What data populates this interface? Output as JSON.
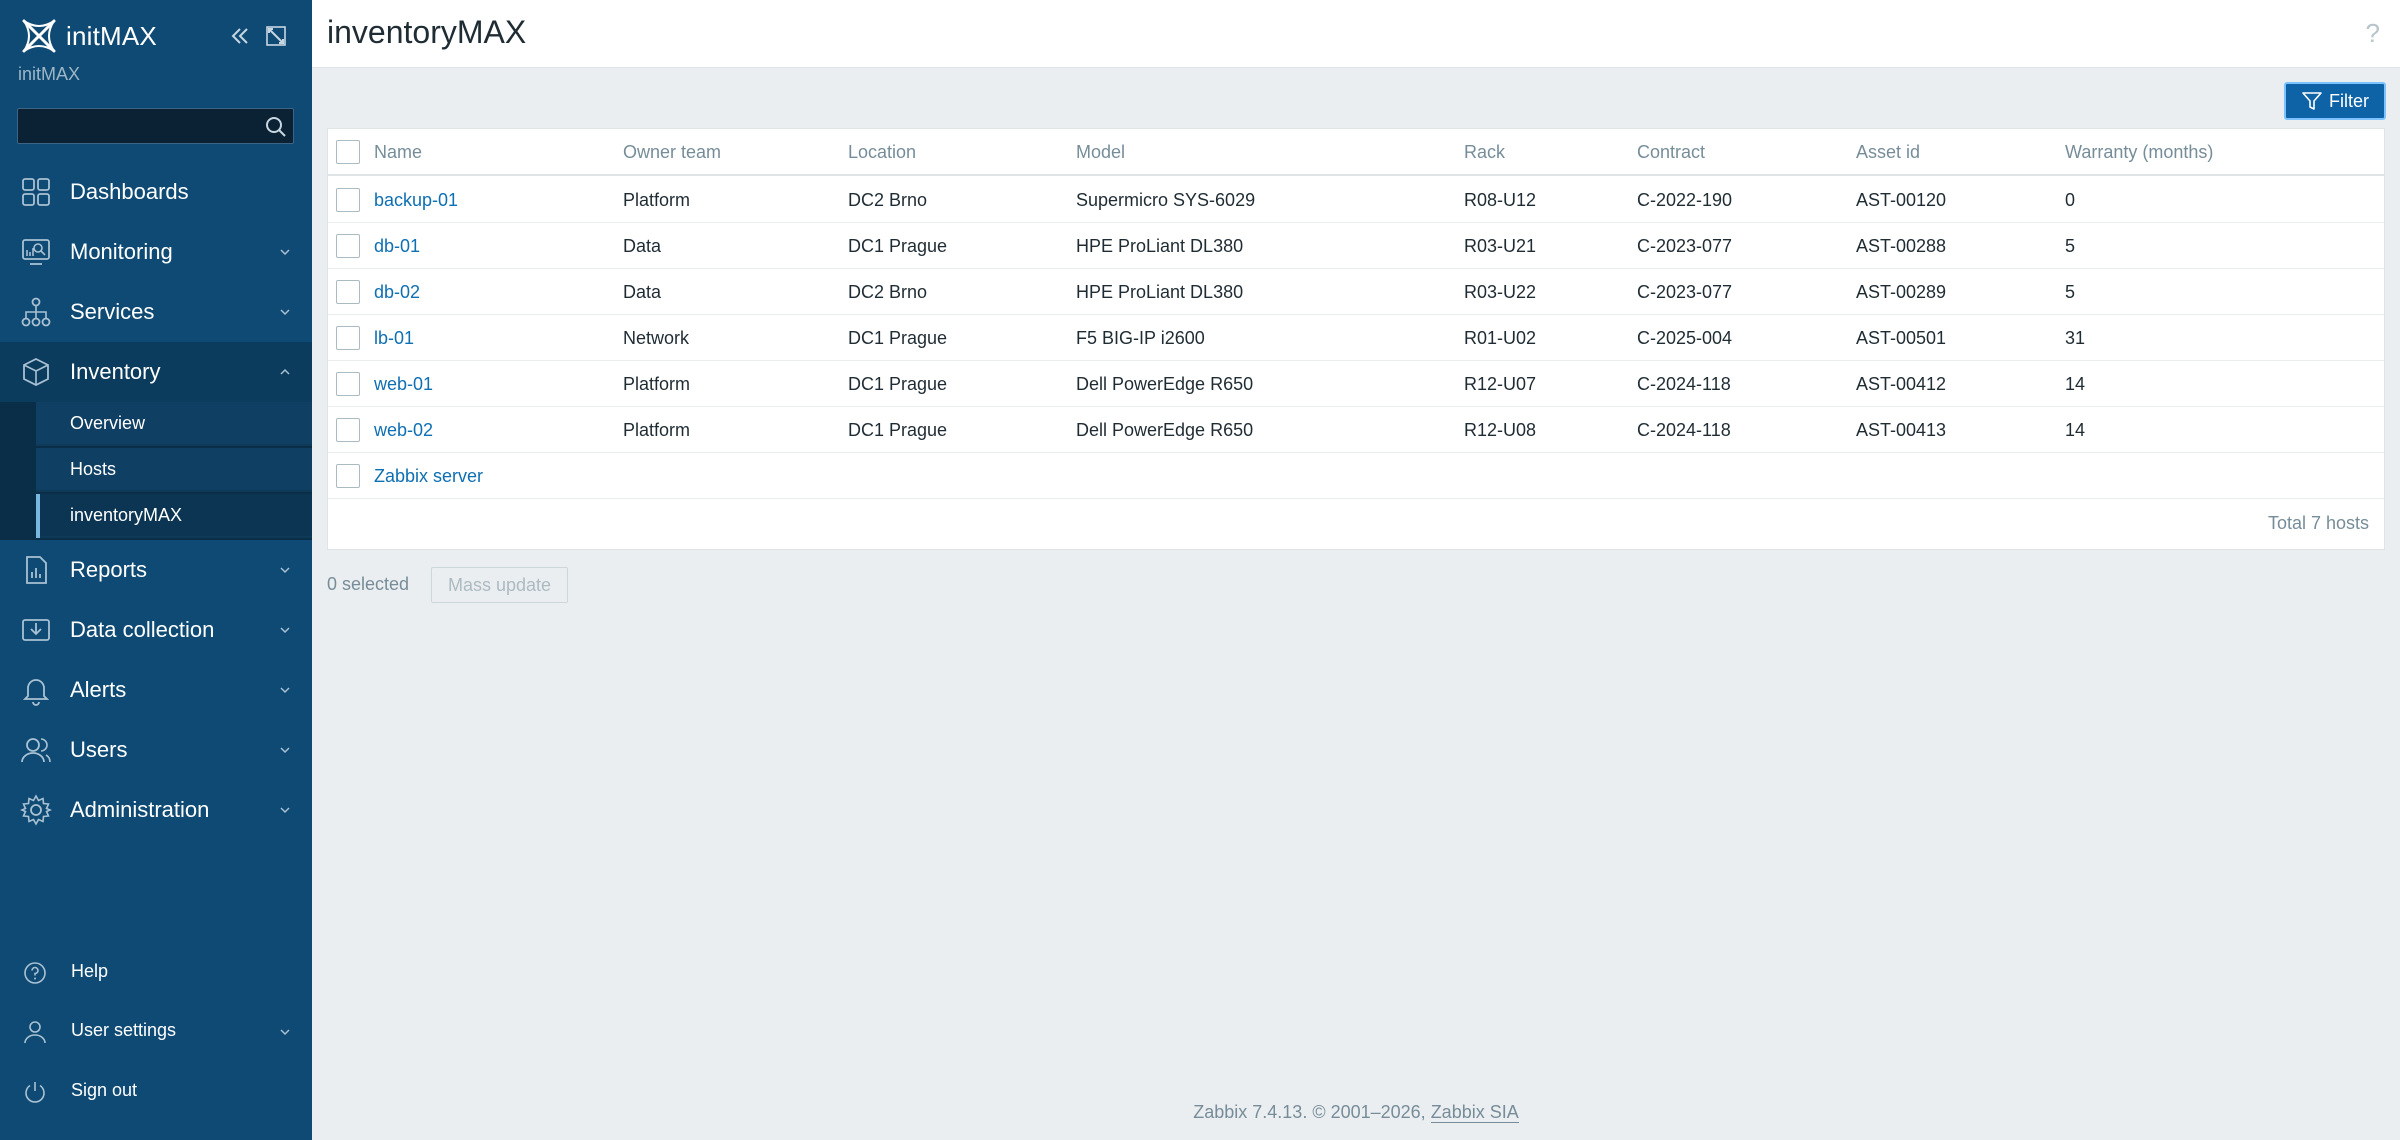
{
  "brand": {
    "name": "initMAX",
    "subtitle": "initMAX"
  },
  "search": {
    "placeholder": "",
    "value": ""
  },
  "nav": {
    "dashboards": "Dashboards",
    "monitoring": "Monitoring",
    "services": "Services",
    "inventory": "Inventory",
    "inventory_sub": [
      "Overview",
      "Hosts",
      "inventoryMAX"
    ],
    "reports": "Reports",
    "data_collection": "Data collection",
    "alerts": "Alerts",
    "users": "Users",
    "administration": "Administration"
  },
  "bottom_nav": {
    "help": "Help",
    "user_settings": "User settings",
    "sign_out": "Sign out"
  },
  "header": {
    "title": "inventoryMAX",
    "help_glyph": "?"
  },
  "filter": {
    "label": "Filter"
  },
  "table": {
    "columns": [
      "Name",
      "Owner team",
      "Location",
      "Model",
      "Rack",
      "Contract",
      "Asset id",
      "Warranty (months)"
    ],
    "rows": [
      {
        "name": "backup-01",
        "owner": "Platform",
        "location": "DC2 Brno",
        "model": "Supermicro SYS-6029",
        "rack": "R08-U12",
        "contract": "C-2022-190",
        "asset": "AST-00120",
        "warranty": "0"
      },
      {
        "name": "db-01",
        "owner": "Data",
        "location": "DC1 Prague",
        "model": "HPE ProLiant DL380",
        "rack": "R03-U21",
        "contract": "C-2023-077",
        "asset": "AST-00288",
        "warranty": "5"
      },
      {
        "name": "db-02",
        "owner": "Data",
        "location": "DC2 Brno",
        "model": "HPE ProLiant DL380",
        "rack": "R03-U22",
        "contract": "C-2023-077",
        "asset": "AST-00289",
        "warranty": "5"
      },
      {
        "name": "lb-01",
        "owner": "Network",
        "location": "DC1 Prague",
        "model": "F5 BIG-IP i2600",
        "rack": "R01-U02",
        "contract": "C-2025-004",
        "asset": "AST-00501",
        "warranty": "31"
      },
      {
        "name": "web-01",
        "owner": "Platform",
        "location": "DC1 Prague",
        "model": "Dell PowerEdge R650",
        "rack": "R12-U07",
        "contract": "C-2024-118",
        "asset": "AST-00412",
        "warranty": "14"
      },
      {
        "name": "web-02",
        "owner": "Platform",
        "location": "DC1 Prague",
        "model": "Dell PowerEdge R650",
        "rack": "R12-U08",
        "contract": "C-2024-118",
        "asset": "AST-00413",
        "warranty": "14"
      },
      {
        "name": "Zabbix server",
        "owner": "",
        "location": "",
        "model": "",
        "rack": "",
        "contract": "",
        "asset": "",
        "warranty": ""
      }
    ],
    "total": "Total 7 hosts"
  },
  "actions": {
    "selected": "0 selected",
    "mass_update": "Mass update"
  },
  "footer": {
    "text": "Zabbix 7.4.13. © 2001–2026, ",
    "link": "Zabbix SIA"
  },
  "colors": {
    "sidebar": "#0e4a73",
    "link": "#0e6fb3",
    "accent": "#0e63a6"
  }
}
